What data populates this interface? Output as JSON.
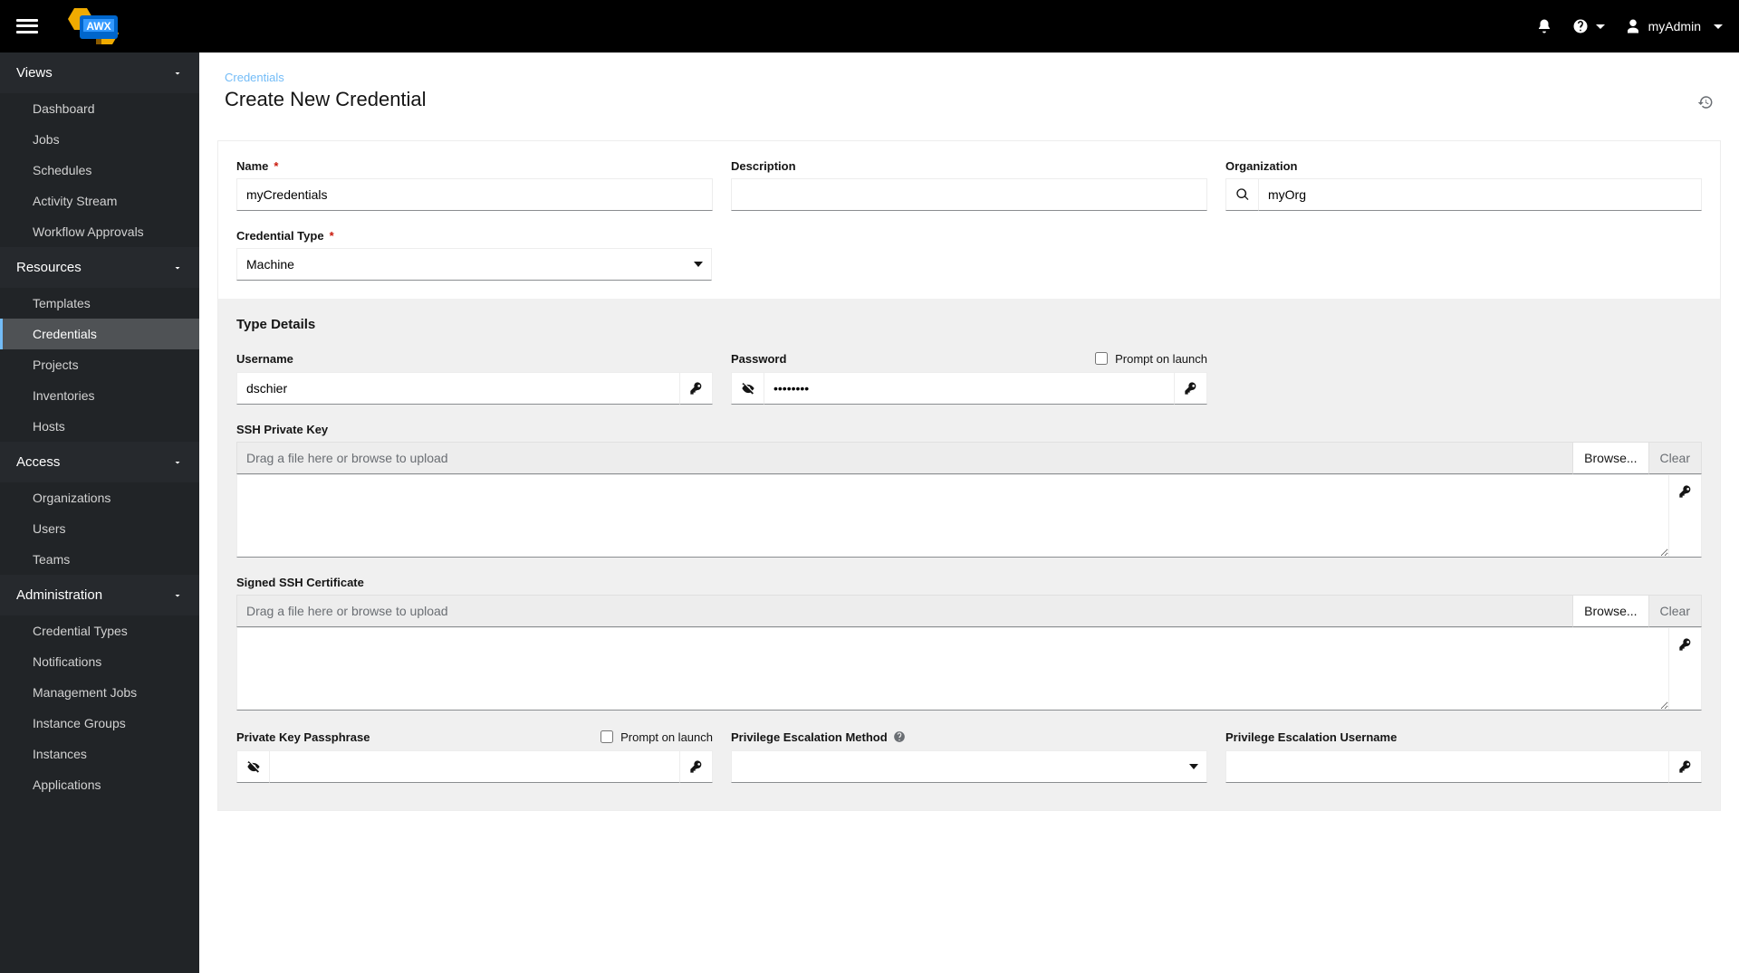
{
  "topbar": {
    "username": "myAdmin"
  },
  "sidebar": {
    "sections": [
      {
        "label": "Views",
        "items": [
          "Dashboard",
          "Jobs",
          "Schedules",
          "Activity Stream",
          "Workflow Approvals"
        ]
      },
      {
        "label": "Resources",
        "items": [
          "Templates",
          "Credentials",
          "Projects",
          "Inventories",
          "Hosts"
        ],
        "activeIndex": 1
      },
      {
        "label": "Access",
        "items": [
          "Organizations",
          "Users",
          "Teams"
        ]
      },
      {
        "label": "Administration",
        "items": [
          "Credential Types",
          "Notifications",
          "Management Jobs",
          "Instance Groups",
          "Instances",
          "Applications"
        ]
      }
    ]
  },
  "page": {
    "breadcrumb": "Credentials",
    "title": "Create New Credential"
  },
  "form": {
    "name_label": "Name",
    "name_value": "myCredentials",
    "desc_label": "Description",
    "desc_value": "",
    "org_label": "Organization",
    "org_value": "myOrg",
    "credtype_label": "Credential Type",
    "credtype_value": "Machine"
  },
  "details": {
    "section_title": "Type Details",
    "username_label": "Username",
    "username_value": "dschier",
    "password_label": "Password",
    "password_value": "••••••••",
    "prompt_label": "Prompt on launch",
    "sshkey_label": "SSH Private Key",
    "drag_placeholder": "Drag a file here or browse to upload",
    "browse_label": "Browse...",
    "clear_label": "Clear",
    "signed_label": "Signed SSH Certificate",
    "passphrase_label": "Private Key Passphrase",
    "escalation_method_label": "Privilege Escalation Method",
    "escalation_user_label": "Privilege Escalation Username"
  }
}
